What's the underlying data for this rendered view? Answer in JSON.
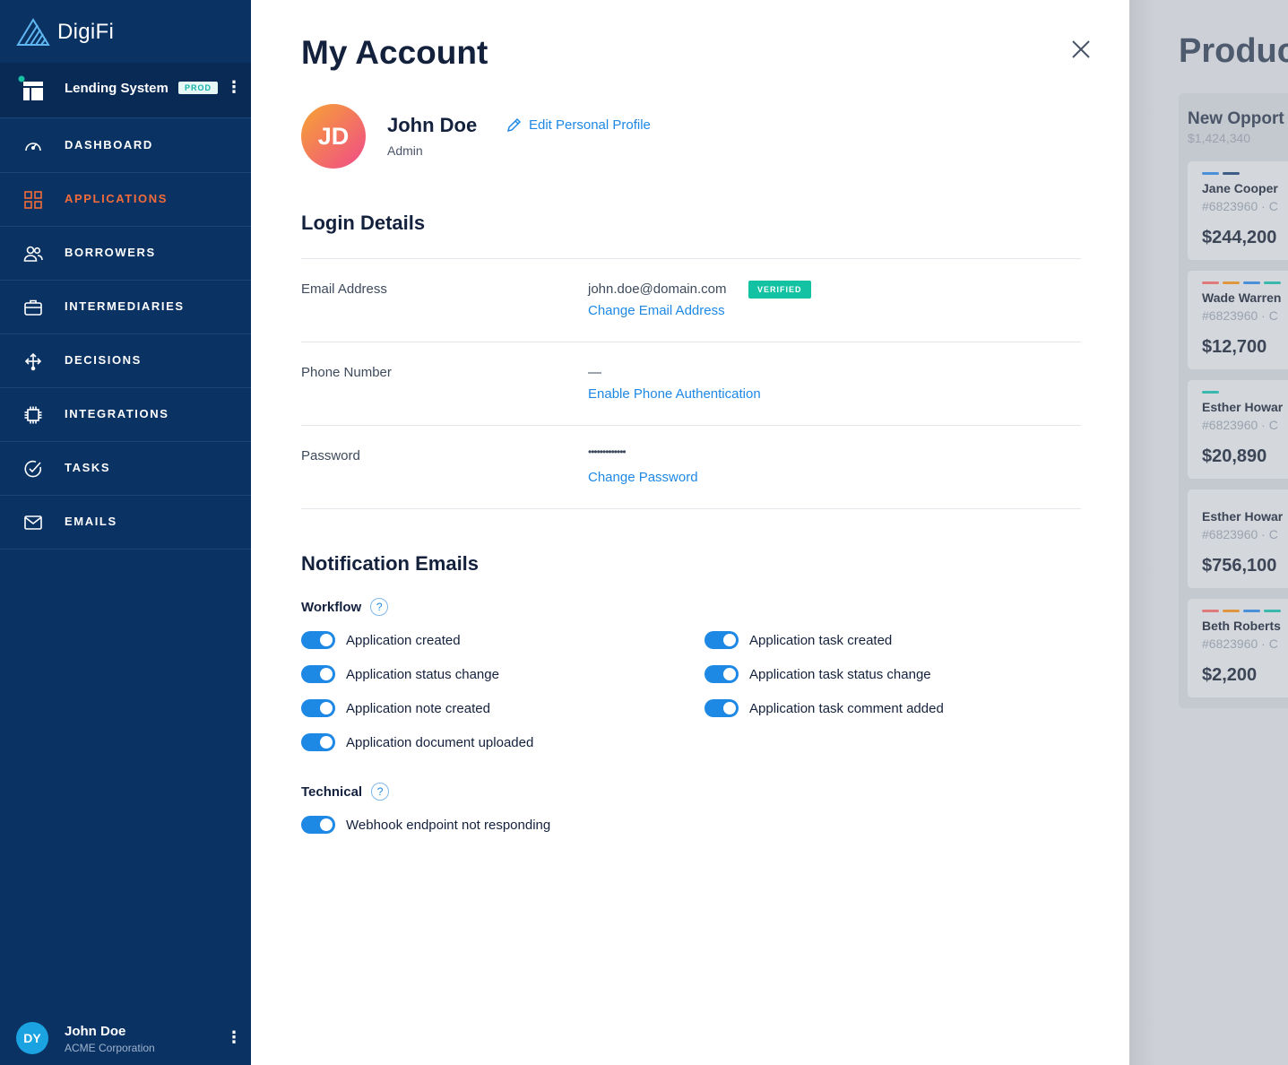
{
  "brand": {
    "name": "DigiFi"
  },
  "system": {
    "name": "Lending System",
    "badge": "PROD",
    "menu_icon": "vertical-dots-icon"
  },
  "nav": [
    {
      "label": "DASHBOARD",
      "icon": "speedometer-icon",
      "active": false
    },
    {
      "label": "APPLICATIONS",
      "icon": "grid-icon",
      "active": true
    },
    {
      "label": "BORROWERS",
      "icon": "users-icon",
      "active": false
    },
    {
      "label": "INTERMEDIARIES",
      "icon": "briefcase-icon",
      "active": false
    },
    {
      "label": "DECISIONS",
      "icon": "branch-icon",
      "active": false
    },
    {
      "label": "INTEGRATIONS",
      "icon": "chip-icon",
      "active": false
    },
    {
      "label": "TASKS",
      "icon": "check-circle-icon",
      "active": false
    },
    {
      "label": "EMAILS",
      "icon": "envelope-icon",
      "active": false
    }
  ],
  "user": {
    "initials": "DY",
    "name": "John Doe",
    "company": "ACME Corporation"
  },
  "panel": {
    "title": "My Account",
    "profile": {
      "initials": "JD",
      "name": "John Doe",
      "role": "Admin",
      "edit_label": "Edit Personal Profile"
    },
    "login": {
      "title": "Login Details",
      "email": {
        "label": "Email Address",
        "value": "john.doe@domain.com",
        "badge": "VERIFIED",
        "action": "Change Email Address"
      },
      "phone": {
        "label": "Phone Number",
        "value": "—",
        "action": "Enable Phone Authentication"
      },
      "password": {
        "label": "Password",
        "value": "•••••••••••••",
        "action": "Change Password"
      }
    },
    "notifications": {
      "title": "Notification Emails",
      "workflow": {
        "title": "Workflow",
        "left": [
          "Application created",
          "Application status change",
          "Application note created",
          "Application document uploaded"
        ],
        "right": [
          "Application task created",
          "Application task status change",
          "Application task comment added"
        ]
      },
      "technical": {
        "title": "Technical",
        "items": [
          "Webhook endpoint not responding"
        ]
      }
    }
  },
  "background": {
    "title": "Produc",
    "column": {
      "title": "New Opport",
      "subtitle": "$1,424,340"
    },
    "cards": [
      {
        "name": "Jane Cooper",
        "id": "#6823960 · C",
        "amount": "$244,200",
        "tags": [
          "#4a90d9",
          "#3d5d87"
        ]
      },
      {
        "name": "Wade Warren",
        "id": "#6823960 · C",
        "amount": "$12,700",
        "tags": [
          "#e07a7a",
          "#e0963f",
          "#4a90d9",
          "#3ab8ad"
        ]
      },
      {
        "name": "Esther Howar",
        "id": "#6823960 · C",
        "amount": "$20,890",
        "tags": [
          "#3ab8ad"
        ]
      },
      {
        "name": "Esther Howar",
        "id": "#6823960 · C",
        "amount": "$756,100",
        "tags": []
      },
      {
        "name": "Beth Roberts",
        "id": "#6823960 · C",
        "amount": "$2,200",
        "tags": [
          "#e07a7a",
          "#e0963f",
          "#4a90d9",
          "#3ab8ad"
        ]
      }
    ]
  },
  "colors": {
    "sidebar": "#0a3263",
    "accent": "#f26b3a",
    "link": "#1e88e5",
    "verified": "#12c2a3"
  }
}
